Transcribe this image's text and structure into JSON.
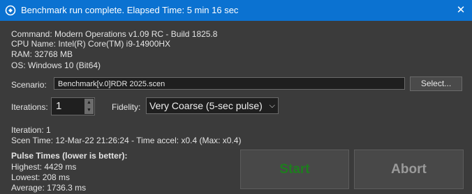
{
  "window": {
    "title": "Benchmark run complete. Elapsed Time: 5 min 16 sec",
    "close_glyph": "✕"
  },
  "system": {
    "command": "Command: Modern Operations v1.09 RC - Build 1825.8",
    "cpu": "CPU Name: Intel(R) Core(TM) i9-14900HX",
    "ram": "RAM: 32768 MB",
    "os": "OS: Windows 10 (Bit64)"
  },
  "scenario": {
    "label": "Scenario:",
    "value": "Benchmark[v.0]RDR 2025.scen",
    "select_label": "Select..."
  },
  "iterations": {
    "label": "Iterations:",
    "value": "1"
  },
  "fidelity": {
    "label": "Fidelity:",
    "value": "Very Coarse (5-sec pulse)"
  },
  "status": {
    "iteration": "Iteration: 1",
    "scen_time": "Scen Time: 12-Mar-22 21:26:24 - Time accel: x0.4 (Max: x0.4)"
  },
  "pulse": {
    "heading": "Pulse Times (lower is better):",
    "highest": "Highest: 4429 ms",
    "lowest": "Lowest: 208 ms",
    "average": "Average: 1736.3 ms"
  },
  "buttons": {
    "start": "Start",
    "abort": "Abort"
  },
  "colors": {
    "titlebar": "#0b72d1",
    "background": "#3b3b3b",
    "start_text": "#1e7d1e"
  }
}
